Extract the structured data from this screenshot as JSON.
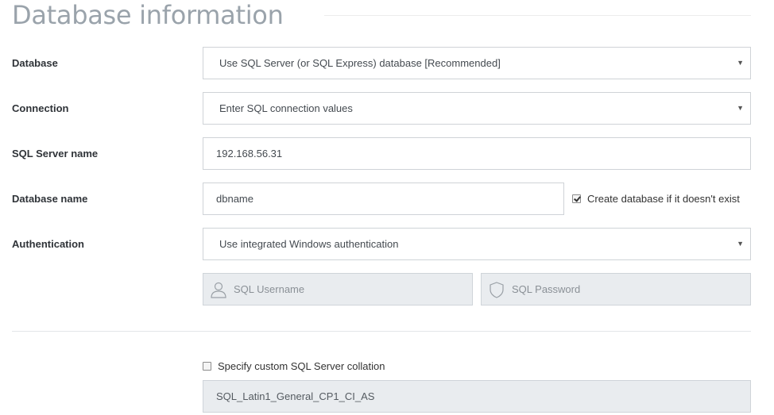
{
  "page": {
    "title": "Database information"
  },
  "fields": {
    "database": {
      "label": "Database",
      "value": "Use SQL Server (or SQL Express) database [Recommended]"
    },
    "connection": {
      "label": "Connection",
      "value": "Enter SQL connection values"
    },
    "server_name": {
      "label": "SQL Server name",
      "value": "192.168.56.31"
    },
    "database_name": {
      "label": "Database name",
      "value": "dbname",
      "create_checkbox_label": "Create database if it doesn't exist",
      "create_checked": true
    },
    "authentication": {
      "label": "Authentication",
      "value": "Use integrated Windows authentication"
    },
    "credentials": {
      "username_placeholder": "SQL Username",
      "password_placeholder": "SQL Password",
      "username_icon": "user-icon",
      "password_icon": "shield-icon"
    },
    "collation": {
      "checkbox_label": "Specify custom SQL Server collation",
      "checked": false,
      "value": "SQL_Latin1_General_CP1_CI_AS"
    }
  },
  "colors": {
    "title": "#9aa3ab",
    "border": "#cfd3d7",
    "disabled_bg": "#e9ecef"
  }
}
